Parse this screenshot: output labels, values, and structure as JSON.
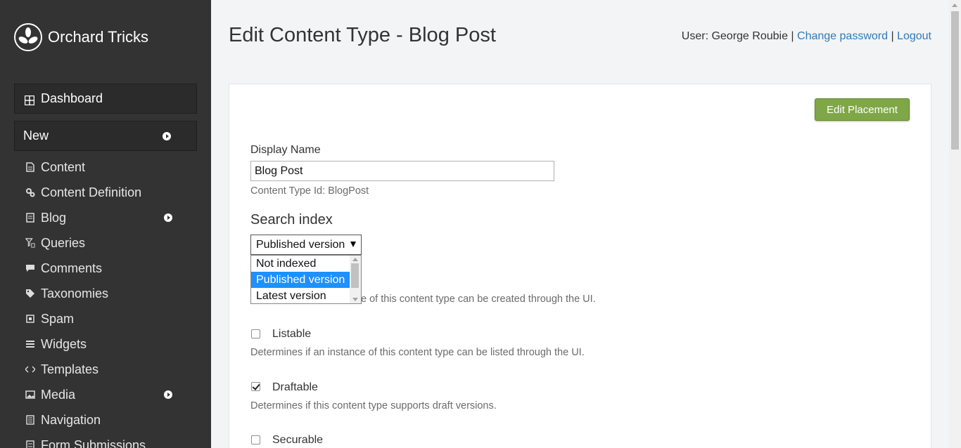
{
  "brand": {
    "name": "Orchard Tricks",
    "icon": "orchard-logo-icon"
  },
  "sidebar": {
    "dashboard": "Dashboard",
    "new": "New",
    "items": [
      {
        "label": "Content",
        "icon": "document-icon",
        "has_submenu": false
      },
      {
        "label": "Content Definition",
        "icon": "cogs-icon",
        "has_submenu": false
      },
      {
        "label": "Blog",
        "icon": "blog-icon",
        "has_submenu": true
      },
      {
        "label": "Queries",
        "icon": "filter-icon",
        "has_submenu": false
      },
      {
        "label": "Comments",
        "icon": "comment-icon",
        "has_submenu": false
      },
      {
        "label": "Taxonomies",
        "icon": "tags-icon",
        "has_submenu": false
      },
      {
        "label": "Spam",
        "icon": "spam-icon",
        "has_submenu": false
      },
      {
        "label": "Widgets",
        "icon": "widgets-icon",
        "has_submenu": false
      },
      {
        "label": "Templates",
        "icon": "code-icon",
        "has_submenu": false
      },
      {
        "label": "Media",
        "icon": "image-icon",
        "has_submenu": true
      },
      {
        "label": "Navigation",
        "icon": "list-icon",
        "has_submenu": false
      },
      {
        "label": "Form Submissions",
        "icon": "form-icon",
        "has_submenu": false
      }
    ]
  },
  "header": {
    "title": "Edit Content Type - Blog Post",
    "user_prefix": "User: George Roubie",
    "sep": "|",
    "change_password": "Change password",
    "logout": "Logout"
  },
  "form": {
    "edit_placement": "Edit Placement",
    "display_name_label": "Display Name",
    "display_name_value": "Blog Post",
    "content_type_id": "Content Type Id: BlogPost",
    "search_index_heading": "Search index",
    "search_index_selected": "Published version",
    "search_index_options": [
      "Not indexed",
      "Published version",
      "Latest version"
    ],
    "creatable_hint_partial": "e of this content type can be created through the UI.",
    "listable_label": "Listable",
    "listable_checked": false,
    "listable_hint": "Determines if an instance of this content type can be listed through the UI.",
    "draftable_label": "Draftable",
    "draftable_checked": true,
    "draftable_hint": "Determines if this content type supports draft versions.",
    "securable_label": "Securable",
    "securable_checked": false
  },
  "colors": {
    "sidebar_bg": "#333333",
    "accent_green": "#7fa748",
    "link": "#2e7bb8",
    "selected_option": "#1e90ff"
  }
}
